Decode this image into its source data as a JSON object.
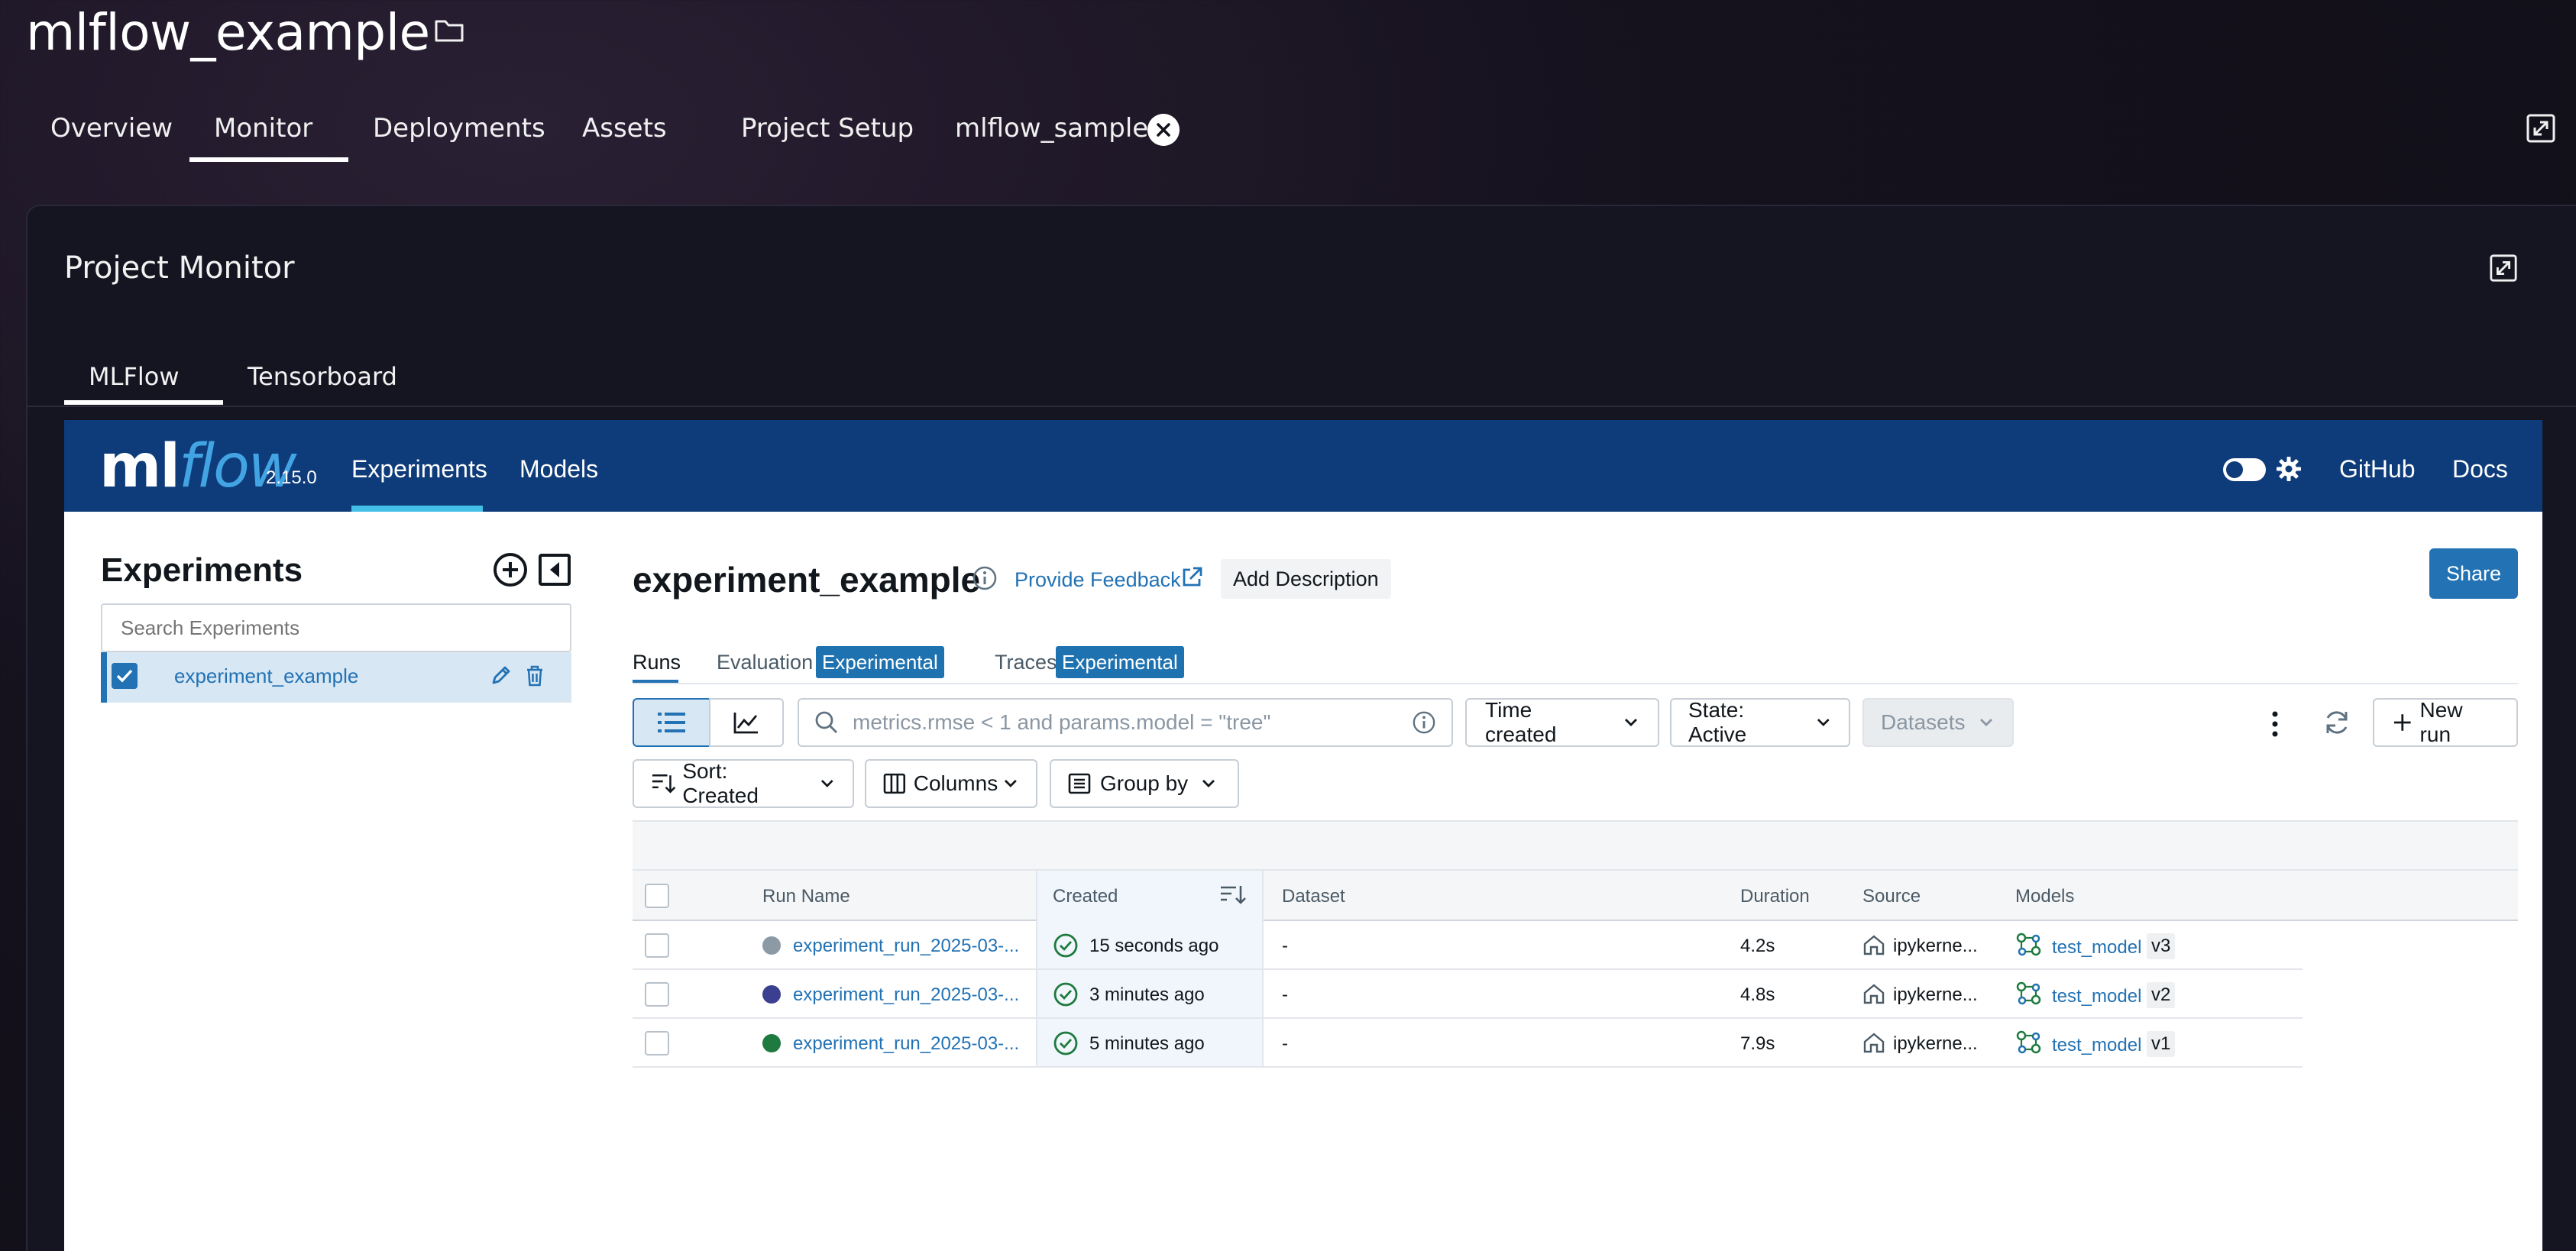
{
  "project": {
    "title": "mlflow_example",
    "tabs": [
      "Overview",
      "Monitor",
      "Deployments",
      "Assets",
      "Project Setup",
      "mlflow_sample"
    ],
    "active_tab": "Monitor"
  },
  "monitor": {
    "title": "Project Monitor",
    "subtabs": [
      "MLFlow",
      "Tensorboard"
    ],
    "active_subtab": "MLFlow"
  },
  "mlflow": {
    "logo_ml": "ml",
    "logo_flow": "flow",
    "version": "2.15.0",
    "nav": [
      "Experiments",
      "Models"
    ],
    "active_nav": "Experiments",
    "right_links": [
      "GitHub",
      "Docs"
    ],
    "brand_color": "#0e3c7a"
  },
  "sidebar": {
    "heading": "Experiments",
    "search_placeholder": "Search Experiments",
    "experiments": [
      {
        "name": "experiment_example",
        "checked": true
      }
    ]
  },
  "main": {
    "title": "experiment_example",
    "feedback": "Provide Feedback",
    "add_description": "Add Description",
    "share": "Share",
    "tabs": [
      {
        "label": "Runs",
        "badge": ""
      },
      {
        "label": "Evaluation",
        "badge": "Experimental"
      },
      {
        "label": "Traces",
        "badge": "Experimental"
      }
    ],
    "filter_placeholder": "metrics.rmse < 1 and params.model = \"tree\"",
    "time_created": "Time created",
    "state": "State: Active",
    "datasets": "Datasets",
    "new_run": "New run",
    "sort": "Sort: Created",
    "columns": "Columns",
    "group_by": "Group by"
  },
  "table": {
    "headers": [
      "Run Name",
      "Created",
      "Dataset",
      "Duration",
      "Source",
      "Models"
    ],
    "rows": [
      {
        "run_name": "experiment_run_2025-03-...",
        "color": "#8c9aa6",
        "created": "15 seconds ago",
        "dataset": "-",
        "duration": "4.2s",
        "source": "ipykerne...",
        "model": "test_model",
        "version": "v3"
      },
      {
        "run_name": "experiment_run_2025-03-...",
        "color": "#3b3f8f",
        "created": "3 minutes ago",
        "dataset": "-",
        "duration": "4.8s",
        "source": "ipykerne...",
        "model": "test_model",
        "version": "v2"
      },
      {
        "run_name": "experiment_run_2025-03-...",
        "color": "#1e7a3e",
        "created": "5 minutes ago",
        "dataset": "-",
        "duration": "7.9s",
        "source": "ipykerne...",
        "model": "test_model",
        "version": "v1"
      }
    ]
  }
}
